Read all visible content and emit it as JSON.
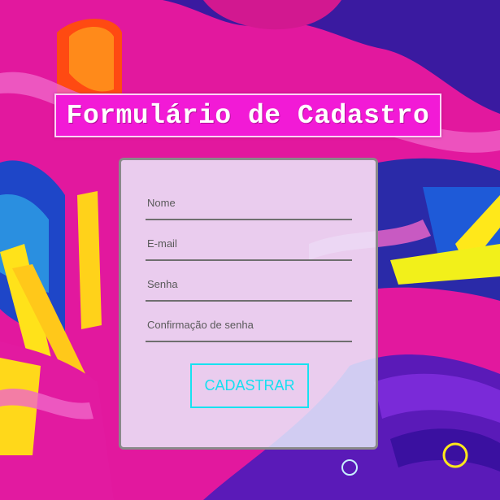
{
  "form": {
    "title": "Formulário de Cadastro",
    "fields": [
      {
        "name": "name",
        "type": "text",
        "value": "",
        "placeholder": "Nome"
      },
      {
        "name": "email",
        "type": "email",
        "value": "",
        "placeholder": "E-mail"
      },
      {
        "name": "password",
        "type": "password",
        "value": "",
        "placeholder": "Senha"
      },
      {
        "name": "password-confirm",
        "type": "password",
        "value": "",
        "placeholder": "Confirmação de senha"
      }
    ],
    "submit_label": "CADASTRAR"
  },
  "colors": {
    "title_background": "#f21ad6",
    "title_border": "#ffd3f6",
    "button_accent": "#17e2f0",
    "field_underline": "#6f6f6f",
    "card_border": "#8a8a8a"
  }
}
